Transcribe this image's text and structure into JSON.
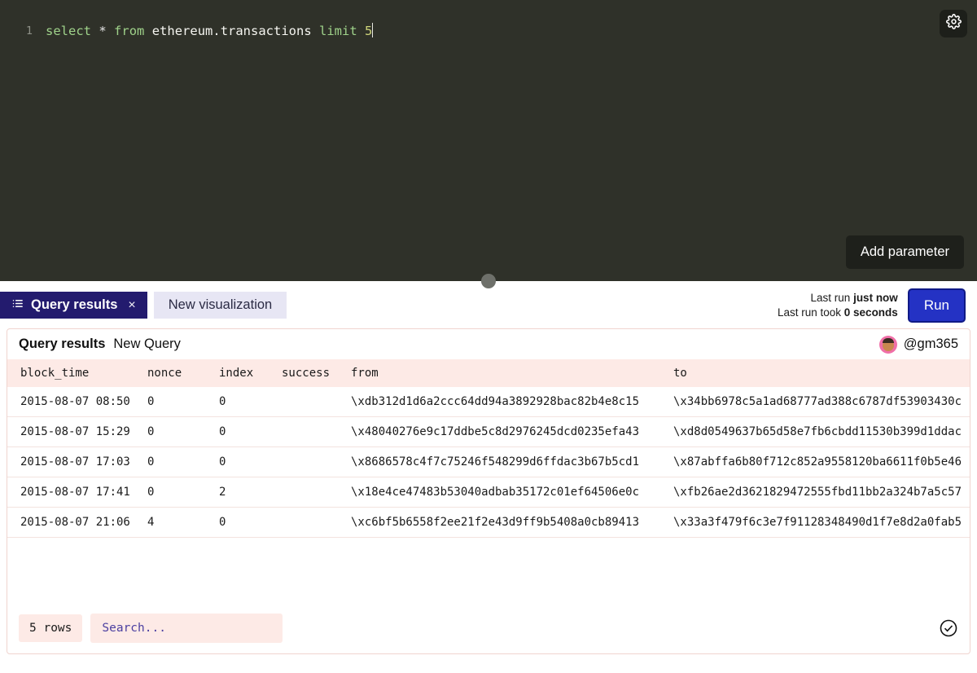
{
  "editor": {
    "line_number": "1",
    "sql_tokens": [
      {
        "text": "select",
        "type": "keyword"
      },
      {
        "text": " ",
        "type": "plain"
      },
      {
        "text": "*",
        "type": "operator"
      },
      {
        "text": " ",
        "type": "plain"
      },
      {
        "text": "from",
        "type": "keyword"
      },
      {
        "text": " ",
        "type": "plain"
      },
      {
        "text": "ethereum.transactions",
        "type": "identifier"
      },
      {
        "text": " ",
        "type": "plain"
      },
      {
        "text": "limit",
        "type": "keyword"
      },
      {
        "text": " ",
        "type": "plain"
      },
      {
        "text": "5",
        "type": "number"
      }
    ],
    "sql_text": "select * from ethereum.transactions limit 5",
    "settings_icon": "gear-icon",
    "add_parameter_label": "Add parameter",
    "background_color": "#2f3129"
  },
  "tabs": [
    {
      "label": "Query results",
      "icon": "list-icon",
      "active": true,
      "closable": true,
      "close_label": "×"
    },
    {
      "label": "New visualization",
      "icon": "",
      "active": false,
      "closable": false
    }
  ],
  "run_panel": {
    "last_run_prefix": "Last run",
    "last_run_value": "just now",
    "took_prefix": "Last run took",
    "took_value": "0 seconds",
    "run_button_label": "Run",
    "run_button_color": "#2432c4"
  },
  "results": {
    "title": "Query results",
    "subtitle": "New Query",
    "username": "@gm365",
    "avatar_icon": "avatar",
    "rows_label": "5 rows",
    "search_placeholder": "Search...",
    "search_value": "",
    "status_icon": "check-circle-icon",
    "header_bg": "#fdeae6",
    "columns": [
      "block_time",
      "nonce",
      "index",
      "success",
      "from",
      "to"
    ],
    "rows": [
      {
        "block_time": "2015-08-07 08:50",
        "nonce": "0",
        "index": "0",
        "success": "",
        "from": "\\xdb312d1d6a2ccc64dd94a3892928bac82b4e8c15",
        "to": "\\x34bb6978c5a1ad68777ad388c6787df53903430c"
      },
      {
        "block_time": "2015-08-07 15:29",
        "nonce": "0",
        "index": "0",
        "success": "",
        "from": "\\x48040276e9c17ddbe5c8d2976245dcd0235efa43",
        "to": "\\xd8d0549637b65d58e7fb6cbdd11530b399d1ddac"
      },
      {
        "block_time": "2015-08-07 17:03",
        "nonce": "0",
        "index": "0",
        "success": "",
        "from": "\\x8686578c4f7c75246f548299d6ffdac3b67b5cd1",
        "to": "\\x87abffa6b80f712c852a9558120ba6611f0b5e46"
      },
      {
        "block_time": "2015-08-07 17:41",
        "nonce": "0",
        "index": "2",
        "success": "",
        "from": "\\x18e4ce47483b53040adbab35172c01ef64506e0c",
        "to": "\\xfb26ae2d3621829472555fbd11bb2a324b7a5c57"
      },
      {
        "block_time": "2015-08-07 21:06",
        "nonce": "4",
        "index": "0",
        "success": "",
        "from": "\\xc6bf5b6558f2ee21f2e43d9ff9b5408a0cb89413",
        "to": "\\x33a3f479f6c3e7f91128348490d1f7e8d2a0fab5"
      }
    ]
  }
}
